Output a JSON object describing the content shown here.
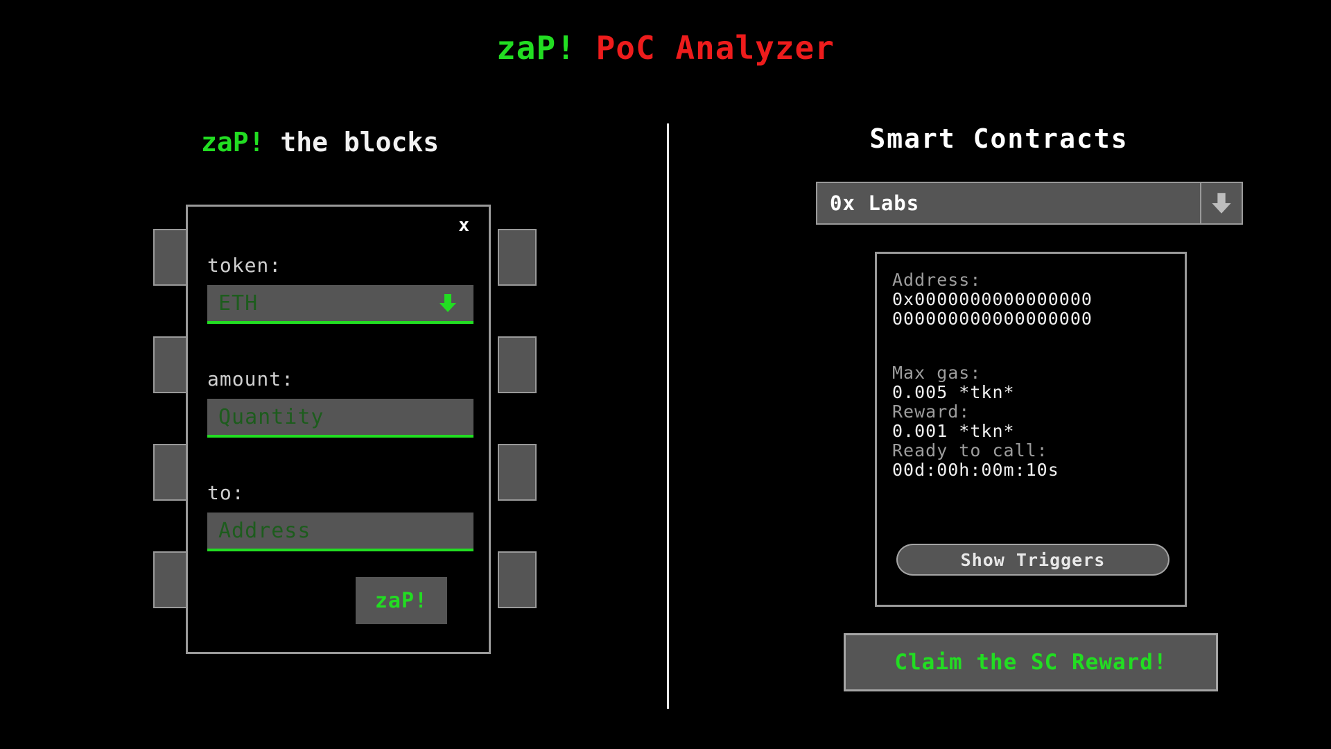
{
  "app": {
    "title_part_1": "zaP!",
    "title_part_2": " PoC Analyzer",
    "accent_green": "#22dd22",
    "accent_red": "#ee1c1c",
    "surface_gray": "#555555",
    "border_gray": "#9a9a9a",
    "background": "#000000"
  },
  "left": {
    "heading_accent": "zaP!",
    "heading_rest": " the blocks",
    "dialog": {
      "close_label": "x",
      "fields": [
        {
          "label": "token:",
          "value": "ETH",
          "placeholder": "ETH",
          "control": "select",
          "icon": "arrow-down-icon"
        },
        {
          "label": "amount:",
          "value": "",
          "placeholder": "Quantity",
          "control": "text",
          "icon": ""
        },
        {
          "label": "to:",
          "value": "",
          "placeholder": "Address",
          "control": "text",
          "icon": ""
        }
      ],
      "submit_label": "zaP!"
    },
    "blocks_count": 8
  },
  "right": {
    "heading": "Smart Contracts",
    "contract_select": {
      "selected": "0x Labs",
      "icon": "arrow-down-icon"
    },
    "info": {
      "address_label": "Address:",
      "address_line_1": "0x0000000000000000",
      "address_line_2": "000000000000000000",
      "max_gas_label": "Max gas:",
      "max_gas_value": "0.005 *tkn*",
      "reward_label": "Reward:",
      "reward_value": "0.001 *tkn*",
      "ready_label": "Ready to call:",
      "ready_value": "00d:00h:00m:10s",
      "show_triggers_label": "Show Triggers"
    },
    "claim_label": "Claim the SC Reward!"
  }
}
